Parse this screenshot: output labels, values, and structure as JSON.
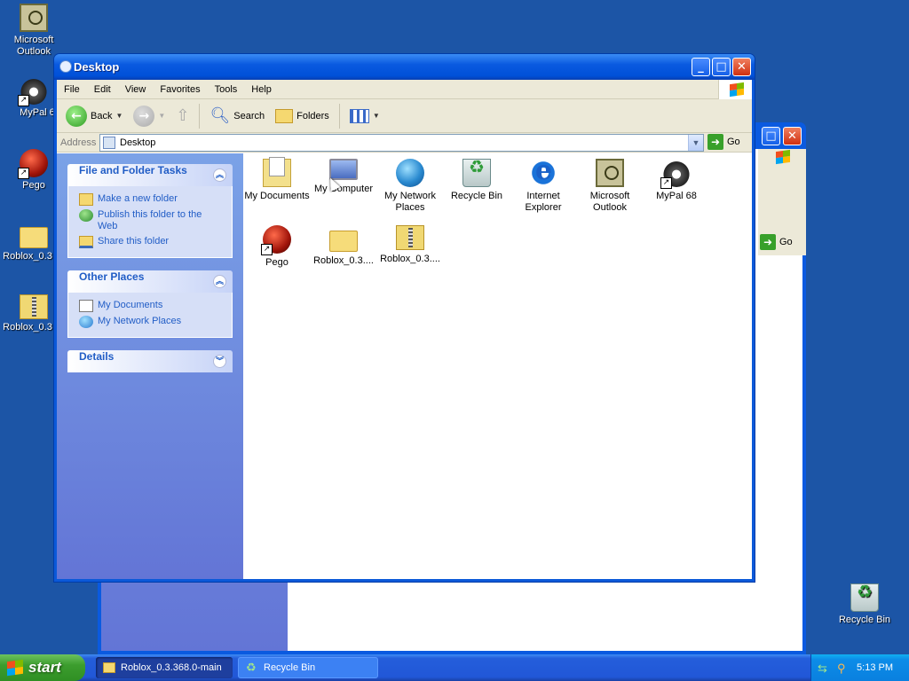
{
  "desktop_icons": [
    {
      "label": "Microsoft Outlook",
      "icon": "outlook-icon"
    },
    {
      "label": "MyPal 68",
      "icon": "mypal-icon"
    },
    {
      "label": "Pego",
      "icon": "pego-icon"
    },
    {
      "label": "Roblox_0.3",
      "icon": "folder-icon"
    },
    {
      "label": "Roblox_0.3",
      "icon": "zip-folder-icon"
    },
    {
      "label": "Recycle Bin",
      "icon": "recycle-bin-icon"
    }
  ],
  "background_window": {
    "go_label": "Go"
  },
  "window": {
    "title": "Desktop",
    "menu": [
      "File",
      "Edit",
      "View",
      "Favorites",
      "Tools",
      "Help"
    ],
    "toolbar": {
      "back": "Back",
      "search": "Search",
      "folders": "Folders"
    },
    "address": {
      "label": "Address",
      "value": "Desktop",
      "go": "Go"
    },
    "tasks": {
      "file_folder": {
        "title": "File and Folder Tasks",
        "items": [
          "Make a new folder",
          "Publish this folder to the Web",
          "Share this folder"
        ]
      },
      "other_places": {
        "title": "Other Places",
        "items": [
          "My Documents",
          "My Network Places"
        ]
      },
      "details": {
        "title": "Details"
      }
    },
    "files": [
      {
        "label": "My Documents",
        "icon": "my-documents-icon"
      },
      {
        "label": "My Computer",
        "icon": "my-computer-icon"
      },
      {
        "label": "My Network Places",
        "icon": "my-network-places-icon"
      },
      {
        "label": "Recycle Bin",
        "icon": "recycle-bin-icon"
      },
      {
        "label": "Internet Explorer",
        "icon": "internet-explorer-icon"
      },
      {
        "label": "Microsoft Outlook",
        "icon": "outlook-icon"
      },
      {
        "label": "MyPal 68",
        "icon": "mypal-icon"
      },
      {
        "label": "Pego",
        "icon": "pego-icon"
      },
      {
        "label": "Roblox_0.3....",
        "icon": "folder-icon"
      },
      {
        "label": "Roblox_0.3....",
        "icon": "zip-folder-icon"
      }
    ]
  },
  "taskbar": {
    "start_label": "start",
    "tasks": [
      "Roblox_0.3.368.0-main",
      "Recycle Bin"
    ],
    "clock": "5:13 PM"
  }
}
